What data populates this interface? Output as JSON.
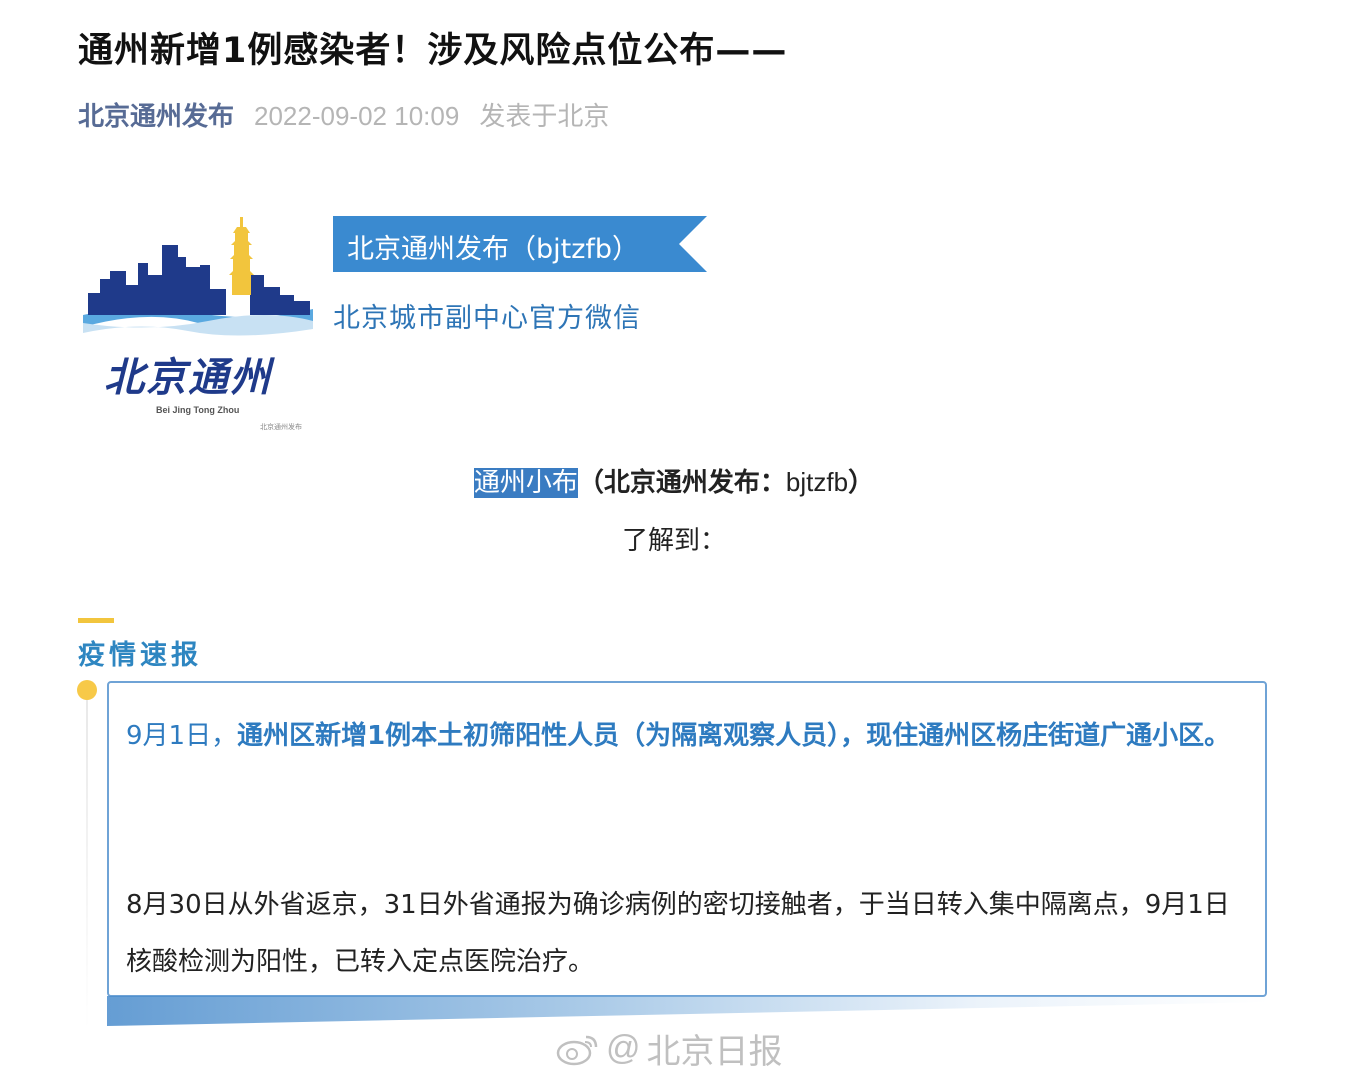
{
  "article": {
    "title": "通州新增1例感染者！涉及风险点位公布——",
    "account": "北京通州发布",
    "date": "2022-09-02 10:09",
    "location": "发表于北京"
  },
  "header_card": {
    "logo_text": "北京通州",
    "logo_pinyin": "Bei Jing Tong Zhou",
    "logo_small": "北京通州发布",
    "ribbon_label": "北京通州发布（bjtzfb）",
    "slogan": "北京城市副中心官方微信"
  },
  "intro": {
    "highlight": "通州小布",
    "source_open": "（北京通州发布：",
    "handle": "bjtzfb",
    "source_close": "）",
    "learned": "了解到："
  },
  "section": {
    "title": "疫情速报",
    "p1_date": "9月1日，",
    "p1_bold": "通州区新增1例本土初筛阳性人员（为隔离观察人员），现住通州区杨庄街道广通小区。",
    "p2": "8月30日从外省返京，31日外省通报为确诊病例的密切接触者，于当日转入集中隔离点，9月1日核酸检测为阳性，已转入定点医院治疗。"
  },
  "watermark": {
    "at": "@",
    "text": "北京日报"
  },
  "colors": {
    "accent_blue": "#3a7cc2",
    "link_blue": "#576b95",
    "yellow": "#f2c53d"
  }
}
